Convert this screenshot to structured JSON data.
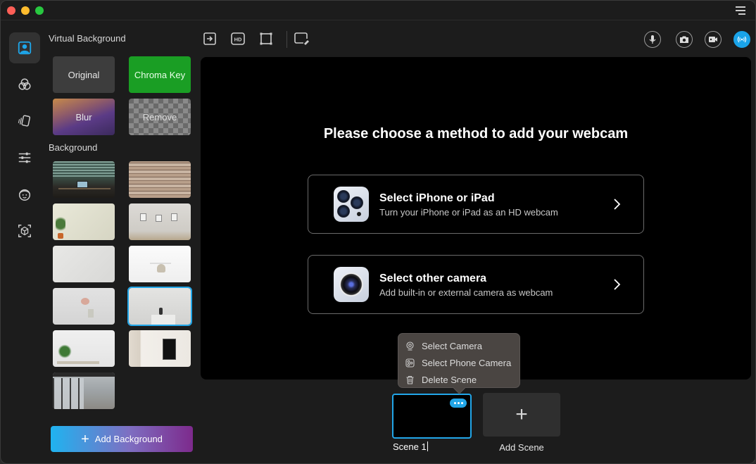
{
  "window": {
    "controls": [
      "close",
      "minimize",
      "maximize"
    ],
    "menu_icon": "hamburger-menu-icon"
  },
  "rail": {
    "items": [
      {
        "name": "virtual-background",
        "icon": "person-portrait-icon",
        "active": true
      },
      {
        "name": "filters",
        "icon": "color-circles-icon",
        "active": false
      },
      {
        "name": "stickers",
        "icon": "cards-icon",
        "active": false
      },
      {
        "name": "adjustments",
        "icon": "sliders-icon",
        "active": false
      },
      {
        "name": "avatar",
        "icon": "avatar-face-icon",
        "active": false
      },
      {
        "name": "ar-effects",
        "icon": "ar-cube-icon",
        "active": false
      }
    ]
  },
  "panel": {
    "virtual_title": "Virtual Background",
    "modes": [
      {
        "label": "Original"
      },
      {
        "label": "Chroma Key"
      },
      {
        "label": "Blur"
      },
      {
        "label": "Remove"
      }
    ],
    "background_title": "Background",
    "backgrounds": [
      {
        "desc": "office desk with window blinds"
      },
      {
        "desc": "brick wall"
      },
      {
        "desc": "white wall with plant"
      },
      {
        "desc": "wall with framed pictures"
      },
      {
        "desc": "white textured wall"
      },
      {
        "desc": "white room with chair"
      },
      {
        "desc": "white wall with round mirror"
      },
      {
        "desc": "white room with cabinet",
        "selected": true
      },
      {
        "desc": "shelf with plants"
      },
      {
        "desc": "wall with black poster"
      },
      {
        "desc": "glass office corridor"
      }
    ],
    "add_button": "Add Background"
  },
  "toolbar": {
    "left_tools": [
      {
        "name": "export",
        "icon": "export-arrow-icon"
      },
      {
        "name": "hd",
        "icon": "hd-icon"
      },
      {
        "name": "crop",
        "icon": "crop-frame-icon"
      },
      {
        "name": "edit-overlay",
        "icon": "edit-rect-icon"
      }
    ],
    "right_tools": [
      {
        "name": "microphone",
        "icon": "microphone-icon"
      },
      {
        "name": "snapshot",
        "icon": "camera-icon"
      },
      {
        "name": "record",
        "icon": "video-icon"
      },
      {
        "name": "live",
        "icon": "broadcast-icon",
        "active": true
      }
    ]
  },
  "stage": {
    "title": "Please choose a method to add your webcam",
    "methods": [
      {
        "title": "Select iPhone or iPad",
        "subtitle": "Turn your iPhone or iPad as an HD webcam"
      },
      {
        "title": "Select other camera",
        "subtitle": "Add built-in or external camera as webcam"
      }
    ]
  },
  "context_menu": {
    "items": [
      {
        "label": "Select Camera",
        "icon": "webcam-icon"
      },
      {
        "label": "Select Phone Camera",
        "icon": "phone-camera-icon"
      },
      {
        "label": "Delete Scene",
        "icon": "trash-icon"
      }
    ]
  },
  "scenes": {
    "items": [
      {
        "label": "Scene 1",
        "selected": true
      }
    ],
    "add_label": "Add Scene"
  },
  "colors": {
    "accent": "#22a6e8",
    "chroma_green": "#1a9e24",
    "window_bg": "#1c1c1c",
    "stage_bg": "#000000"
  }
}
